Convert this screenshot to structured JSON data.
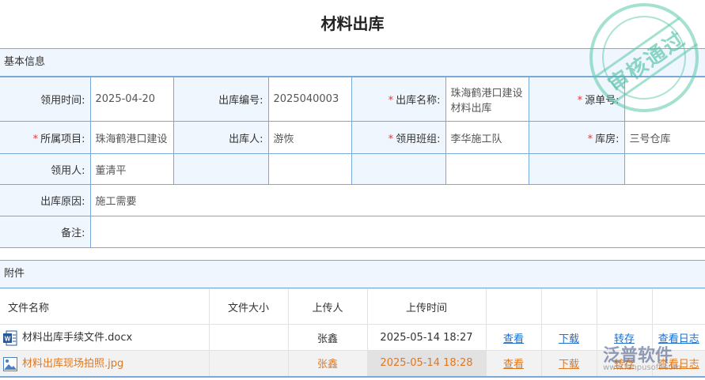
{
  "title": "材料出库",
  "basic": {
    "section": "基本信息",
    "fields": {
      "receive_time_label": "领用时间:",
      "receive_time": "2025-04-20",
      "out_no_label": "出库编号:",
      "out_no": "2025040003",
      "out_name_label": "出库名称:",
      "out_name": "珠海鹤港口建设材料出库",
      "source_no_label": "源单号:",
      "source_no": "",
      "project_label": "所属项目:",
      "project": "珠海鹤港口建设",
      "out_person_label": "出库人:",
      "out_person": "游恢",
      "team_label": "领用班组:",
      "team": "李华施工队",
      "warehouse_label": "库房:",
      "warehouse": "三号仓库",
      "receiver_label": "领用人:",
      "receiver": "董清平",
      "reason_label": "出库原因:",
      "reason": "施工需要",
      "remark_label": "备注:",
      "remark": ""
    },
    "required_mark": "*"
  },
  "attachments": {
    "section": "附件",
    "headers": [
      "文件名称",
      "文件大小",
      "上传人",
      "上传时间"
    ],
    "rows": [
      {
        "name": "材料出库手续文件.docx",
        "size": "",
        "uploader": "张鑫",
        "time": "2025-05-14 18:27",
        "icon": "word-file-icon"
      },
      {
        "name": "材料出库现场拍照.jpg",
        "size": "",
        "uploader": "张鑫",
        "time": "2025-05-14 18:28",
        "icon": "image-file-icon"
      }
    ],
    "actions": [
      "查看",
      "下载",
      "转存",
      "查看日志"
    ]
  },
  "stamp": "审核通过",
  "watermark": {
    "brand": "泛普软件",
    "url": "www.fanpusoft.com"
  },
  "colors": {
    "border": "#7aa9d8",
    "label_bg": "#f0f6fd",
    "link": "#1a6fd0",
    "selected": "#e07820"
  }
}
